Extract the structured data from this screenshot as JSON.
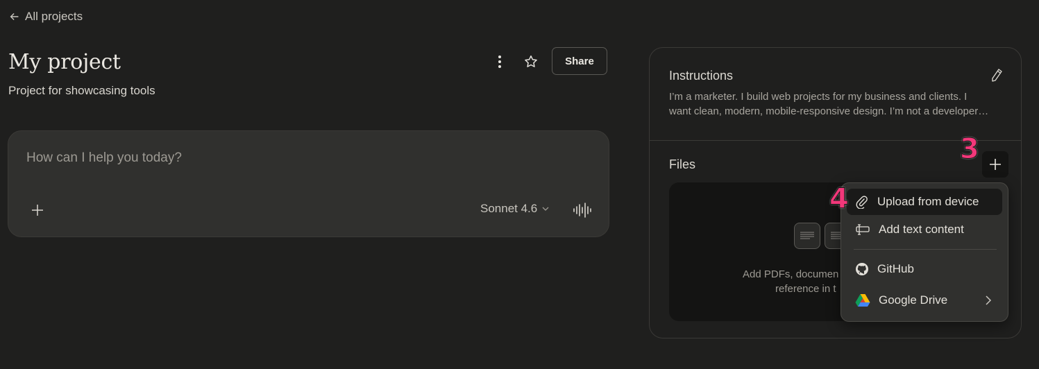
{
  "nav": {
    "back_label": "All projects"
  },
  "project": {
    "title": "My project",
    "subtitle": "Project for showcasing tools",
    "share_label": "Share"
  },
  "chat": {
    "placeholder": "How can I help you today?",
    "model": "Sonnet 4.6"
  },
  "instructions": {
    "title": "Instructions",
    "line1": "I’m a marketer. I build web projects for my business and clients. I",
    "line2": "want clean, modern, mobile-responsive design. I’m not a developer…"
  },
  "files": {
    "title": "Files",
    "empty_line1": "Add PDFs, documen",
    "empty_line2": "reference in t"
  },
  "annotations": {
    "step3": "3",
    "step4": "4",
    "color": "#f2387a"
  },
  "menu": {
    "upload": "Upload from device",
    "text": "Add text content",
    "github": "GitHub",
    "drive": "Google Drive"
  }
}
